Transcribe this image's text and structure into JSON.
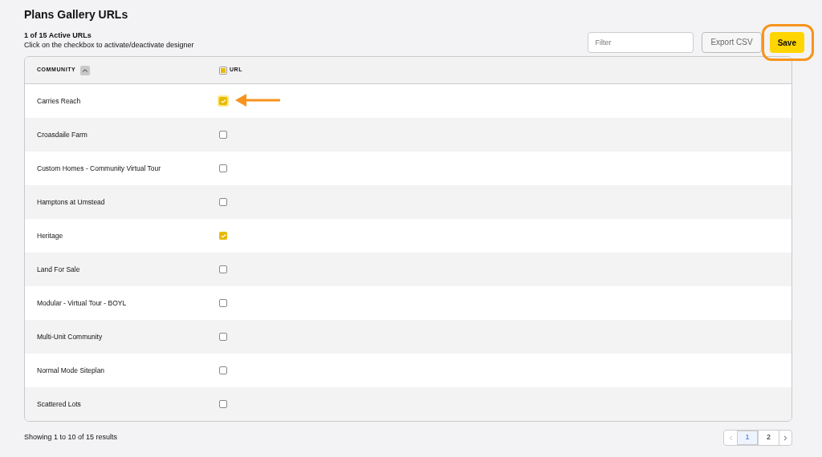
{
  "title": "Plans Gallery URLs",
  "summary": {
    "count": "1 of 15 Active URLs",
    "hint": "Click on the checkbox to activate/deactivate designer"
  },
  "toolbar": {
    "filter": {
      "placeholder": "Filter"
    },
    "export": {
      "label": "Export CSV"
    },
    "save": {
      "label": "Save",
      "annotated": true
    }
  },
  "table": {
    "columns": [
      {
        "label": "COMMUNITY",
        "ascending": true
      },
      {
        "label": "URL",
        "partial": true
      }
    ],
    "rows": [
      {
        "community": "Carries Reach",
        "checked": true,
        "focused": true,
        "annotated": true
      },
      {
        "community": "Croasdaile Farm",
        "checked": false,
        "focused": false,
        "annotated": false
      },
      {
        "community": "Custom Homes - Community Virtual Tour",
        "checked": false,
        "focused": false,
        "annotated": false
      },
      {
        "community": "Hamptons at Umstead",
        "checked": false,
        "focused": false,
        "annotated": false
      },
      {
        "community": "Heritage",
        "checked": true,
        "focused": false,
        "annotated": false
      },
      {
        "community": "Land For Sale",
        "checked": false,
        "focused": false,
        "annotated": false
      },
      {
        "community": "Modular - Virtual Tour - BOYL",
        "checked": false,
        "focused": false,
        "annotated": false
      },
      {
        "community": "Multi-Unit Community",
        "checked": false,
        "focused": false,
        "annotated": false
      },
      {
        "community": "Normal Mode Siteplan",
        "checked": false,
        "focused": false,
        "annotated": false
      },
      {
        "community": "Scattered Lots",
        "checked": false,
        "focused": false,
        "annotated": false
      }
    ]
  },
  "footer": {
    "results": "Showing 1 to 10 of 15 results",
    "pages": [
      {
        "label": "1",
        "selected": true
      },
      {
        "label": "2",
        "selected": false
      }
    ]
  }
}
